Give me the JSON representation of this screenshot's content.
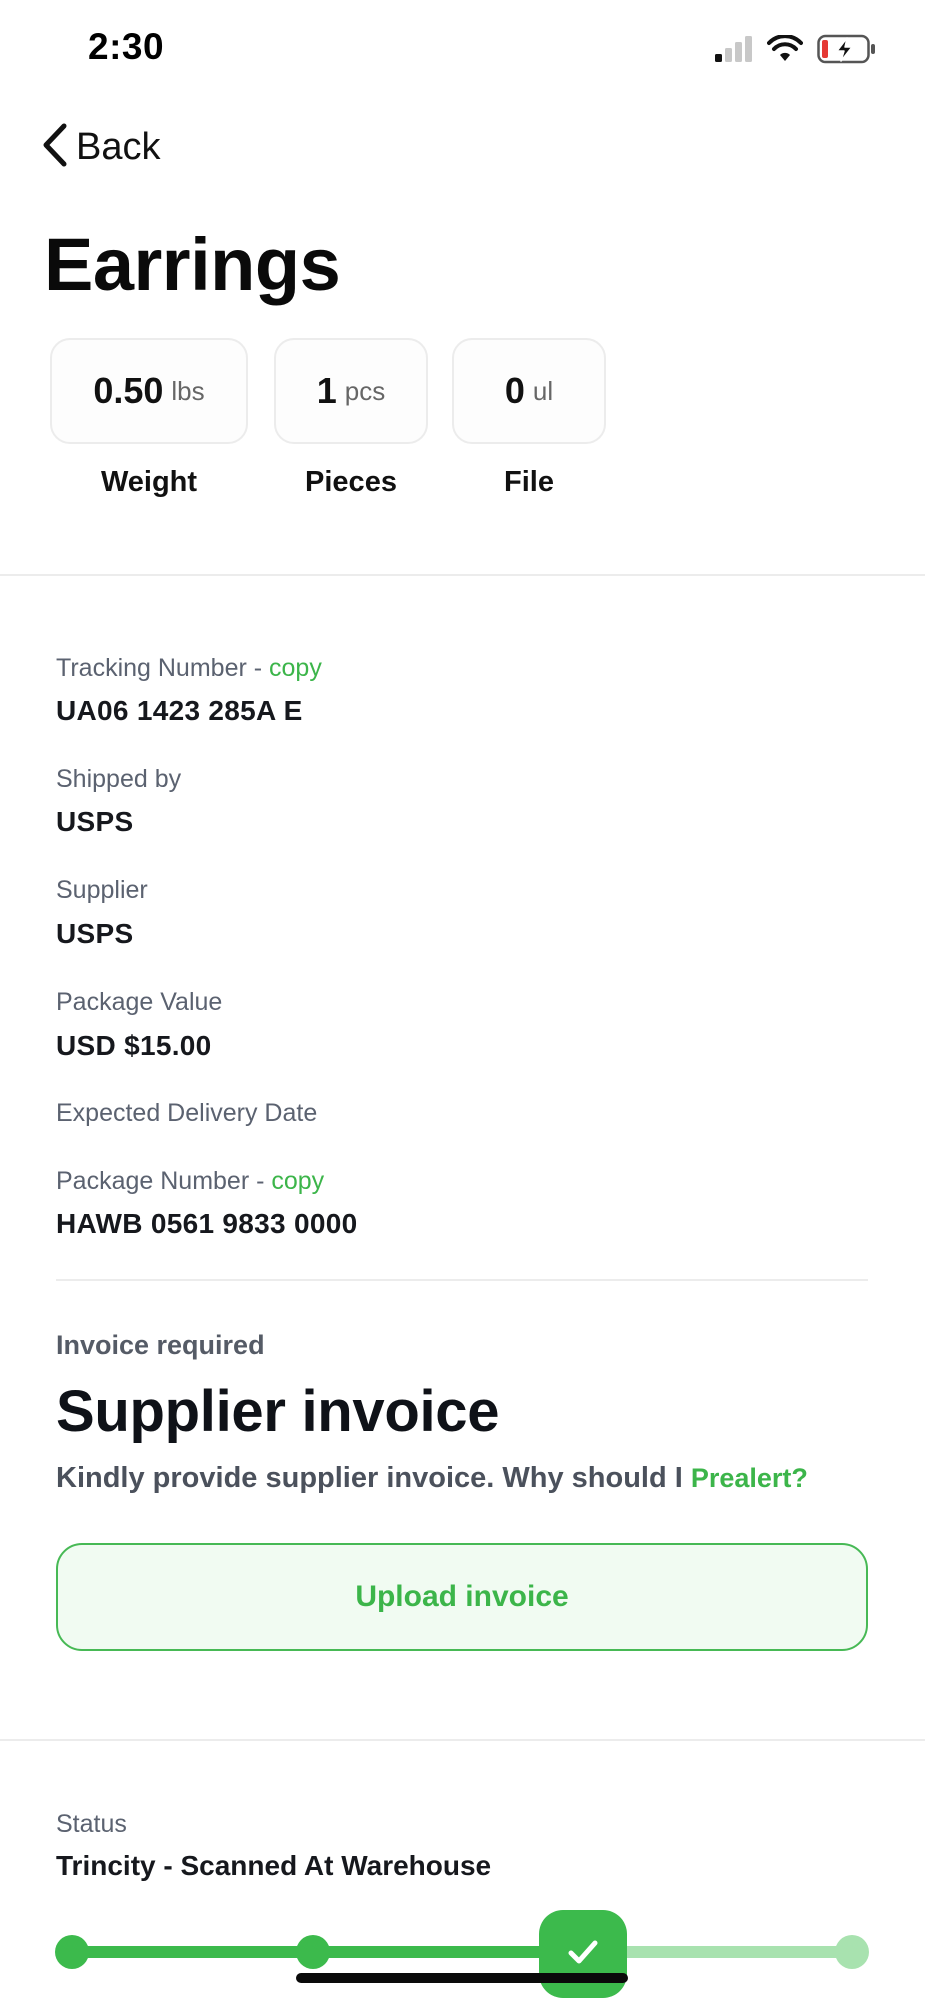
{
  "status_bar": {
    "time": "2:30"
  },
  "nav": {
    "back_label": "Back"
  },
  "page": {
    "title": "Earrings"
  },
  "stats": [
    {
      "value": "0.50",
      "unit": "lbs",
      "label": "Weight"
    },
    {
      "value": "1",
      "unit": "pcs",
      "label": "Pieces"
    },
    {
      "value": "0",
      "unit": "ul",
      "label": "File"
    }
  ],
  "details": {
    "tracking_label": "Tracking Number - ",
    "copy_label": "copy",
    "tracking_value": "UA06 1423 285A E",
    "shipped_by_label": "Shipped by",
    "shipped_by_value": "USPS",
    "supplier_label": "Supplier",
    "supplier_value": "USPS",
    "package_value_label": "Package Value",
    "package_value_value": "USD $15.00",
    "expected_delivery_label": "Expected Delivery Date",
    "package_number_label": "Package Number - ",
    "package_number_value": "HAWB 0561 9833 0000"
  },
  "invoice": {
    "required_label": "Invoice required",
    "title": "Supplier invoice",
    "description": "Kindly provide supplier invoice. Why should I ",
    "prealert_link": "Prealert?",
    "upload_button": "Upload invoice"
  },
  "status": {
    "label": "Status",
    "value": "Trincity - Scanned At Warehouse",
    "current_step": 3,
    "total_steps": 4
  },
  "colors": {
    "accent": "#3cb54a",
    "accent_light": "#a8e2af",
    "upload_bg": "#f1fbf2"
  },
  "icons": [
    "cellular-signal-icon",
    "wifi-icon",
    "battery-charging-icon",
    "chevron-left-icon",
    "checkmark-icon"
  ]
}
